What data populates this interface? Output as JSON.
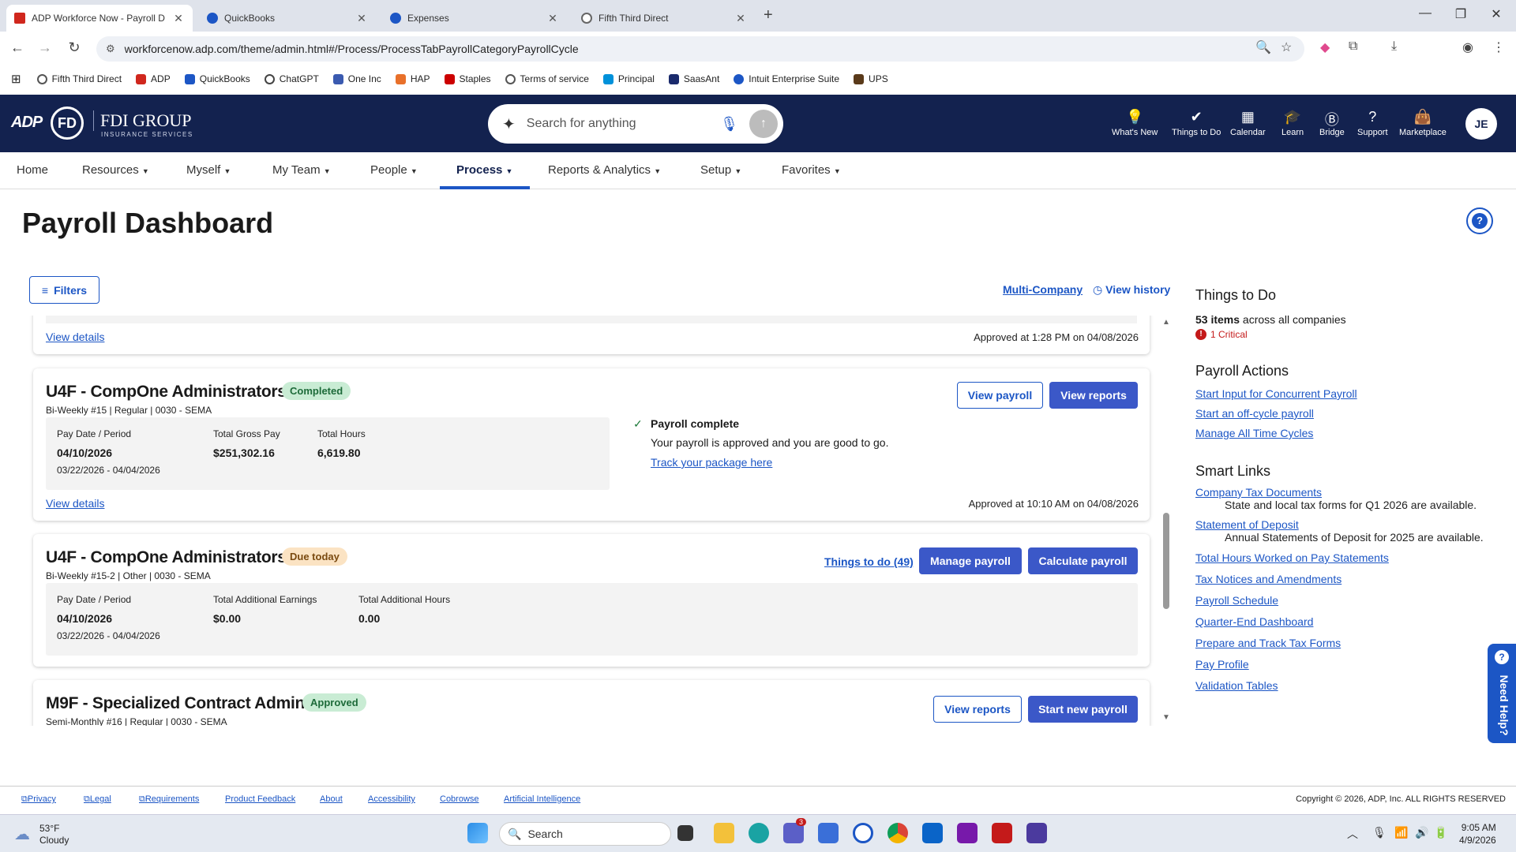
{
  "browser": {
    "tabs": [
      {
        "label": "ADP Workforce Now - Payroll D",
        "active": true
      },
      {
        "label": "QuickBooks",
        "active": false
      },
      {
        "label": "Expenses",
        "active": false
      },
      {
        "label": "Fifth Third Direct",
        "active": false
      }
    ],
    "url": "workforcenow.adp.com/theme/admin.html#/Process/ProcessTabPayrollCategoryPayrollCycle",
    "bookmarks": [
      "Fifth Third Direct",
      "ADP",
      "QuickBooks",
      "ChatGPT",
      "One Inc",
      "HAP",
      "Staples",
      "Terms of service",
      "Principal",
      "SaasAnt",
      "Intuit Enterprise Suite",
      "UPS"
    ]
  },
  "header": {
    "logo": "ADP",
    "brand_mark": "FD",
    "brand_name": "FDI GROUP",
    "brand_sub": "INSURANCE SERVICES",
    "search_placeholder": "Search for anything",
    "items": [
      "What's New",
      "Things to Do",
      "Calendar",
      "Learn",
      "Bridge",
      "Support",
      "Marketplace"
    ],
    "avatar": "JE"
  },
  "nav": {
    "items": [
      "Home",
      "Resources",
      "Myself",
      "My Team",
      "People",
      "Process",
      "Reports & Analytics",
      "Setup",
      "Favorites"
    ],
    "active": "Process"
  },
  "page": {
    "title": "Payroll Dashboard",
    "filters_label": "Filters",
    "multi_company": "Multi-Company",
    "view_history": "View history"
  },
  "cards": {
    "top": {
      "view_details": "View details",
      "approved_at": "Approved at 1:28 PM on 04/08/2026"
    },
    "c1": {
      "title": "U4F - CompOne Administrators",
      "badge": "Completed",
      "subtitle": "Bi-Weekly #15 | Regular | 0030 - SEMA",
      "pay_date_label": "Pay Date / Period",
      "pay_date": "04/10/2026",
      "period": "03/22/2026 - 04/04/2026",
      "gross_label": "Total Gross Pay",
      "gross": "$251,302.16",
      "hours_label": "Total Hours",
      "hours": "6,619.80",
      "status_title": "Payroll complete",
      "status_text": "Your payroll is approved and you are good to go.",
      "track_link": "Track your package here",
      "btn_view_payroll": "View payroll",
      "btn_view_reports": "View reports",
      "view_details": "View details",
      "approved_at": "Approved at 10:10 AM on 04/08/2026"
    },
    "c2": {
      "title": "U4F - CompOne Administrators",
      "badge": "Due today",
      "subtitle": "Bi-Weekly #15-2 | Other | 0030 - SEMA",
      "pay_date_label": "Pay Date / Period",
      "pay_date": "04/10/2026",
      "period": "03/22/2026 - 04/04/2026",
      "earn_label": "Total Additional Earnings",
      "earn": "$0.00",
      "hours_label": "Total Additional Hours",
      "hours": "0.00",
      "things_link": "Things to do (49)",
      "btn_manage": "Manage payroll",
      "btn_calculate": "Calculate payroll"
    },
    "c3": {
      "title": "M9F - Specialized Contract Admin",
      "badge": "Approved",
      "subtitle": "Semi-Monthly #16 | Regular | 0030 - SEMA",
      "btn_view_reports": "View reports",
      "btn_start": "Start new payroll"
    }
  },
  "side": {
    "todo_title": "Things to Do",
    "todo_count": "53 items",
    "todo_rest": " across all companies",
    "critical": "1 Critical",
    "actions_title": "Payroll Actions",
    "actions": [
      "Start Input for Concurrent Payroll",
      "Start an off-cycle payroll",
      "Manage All Time Cycles"
    ],
    "smart_title": "Smart Links",
    "smart": [
      {
        "label": "Company Tax Documents",
        "note": "State and local tax forms for Q1 2026 are available."
      },
      {
        "label": "Statement of Deposit",
        "note": "Annual Statements of Deposit for 2025 are available."
      },
      {
        "label": "Total Hours Worked on Pay Statements"
      },
      {
        "label": "Tax Notices and Amendments"
      },
      {
        "label": "Payroll Schedule"
      },
      {
        "label": "Quarter-End Dashboard"
      },
      {
        "label": "Prepare and Track Tax Forms"
      },
      {
        "label": "Pay Profile"
      },
      {
        "label": "Validation Tables"
      }
    ],
    "need_help": "Need Help?"
  },
  "footer": {
    "links": [
      "Privacy",
      "Legal",
      "Requirements",
      "Product Feedback",
      "About",
      "Accessibility",
      "Cobrowse",
      "Artificial Intelligence"
    ],
    "copyright": "Copyright © 2026, ADP, Inc. ALL RIGHTS RESERVED"
  },
  "taskbar": {
    "temp": "53°F",
    "weather": "Cloudy",
    "search": "Search",
    "teams_badge": "3",
    "time": "9:05 AM",
    "date": "4/9/2026"
  }
}
